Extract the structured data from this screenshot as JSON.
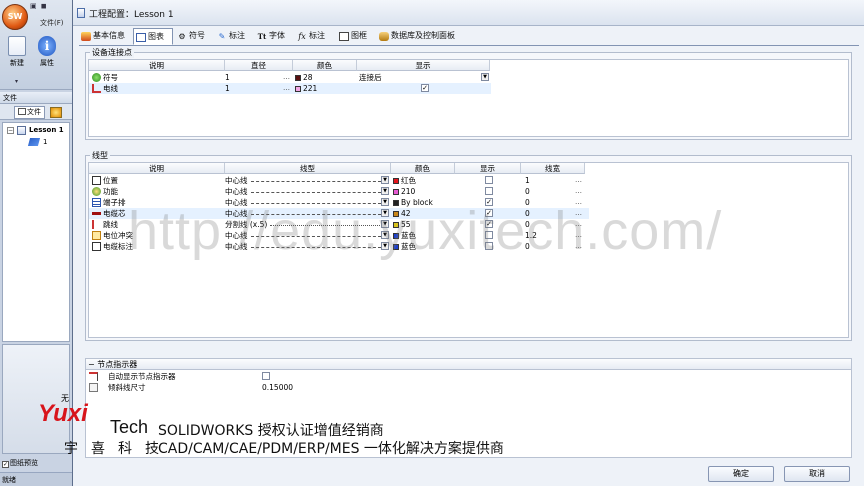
{
  "app": {
    "file_menu": "文件(F)",
    "ribbon": {
      "new_label": "新建",
      "properties_label": "属性"
    },
    "pane_header": "文件",
    "pane_tab_file": "文件",
    "tree": {
      "root": "Lesson 1",
      "child": "1"
    },
    "pane_bottom_text": "无",
    "preview_checkbox": "图纸预览",
    "status": "就绪"
  },
  "dialog": {
    "title": "工程配置：Lesson 1",
    "tabs": [
      {
        "label": "基本信息",
        "icon": "info-icon"
      },
      {
        "label": "图表",
        "icon": "chart-icon"
      },
      {
        "label": "符号",
        "icon": "symbol-icon"
      },
      {
        "label": "标注",
        "icon": "annotation-icon"
      },
      {
        "label": "字体",
        "icon": "font-icon"
      },
      {
        "label": "标注",
        "icon": "fx-icon"
      },
      {
        "label": "图框",
        "icon": "frame-icon"
      },
      {
        "label": "数据库及控制面板",
        "icon": "database-icon"
      }
    ],
    "tab_fx_glyph": "fx",
    "tab_font_glyph": "Tt",
    "connection_points": {
      "title": "设备连接点",
      "headers": [
        "说明",
        "直径",
        "颜色",
        "显示"
      ],
      "rows": [
        {
          "name": "符号",
          "diameter": "1",
          "color": "28",
          "color_hex": "#5a1010",
          "display": "连接后",
          "display_checked": false
        },
        {
          "name": "电线",
          "diameter": "1",
          "color": "221",
          "color_hex": "#f2a7e6",
          "display": "",
          "display_checked": true
        }
      ]
    },
    "line_types": {
      "title": "线型",
      "headers": [
        "说明",
        "线型",
        "颜色",
        "显示",
        "线宽"
      ],
      "rows": [
        {
          "name": "位置",
          "linetype": "中心线",
          "color": "红色",
          "color_hex": "#e3141b",
          "checked": false,
          "width": "1"
        },
        {
          "name": "功能",
          "linetype": "中心线",
          "color": "210",
          "color_hex": "#e65ad2",
          "checked": false,
          "width": "0"
        },
        {
          "name": "端子排",
          "linetype": "中心线",
          "color": "By block",
          "color_hex": "#222222",
          "checked": true,
          "width": "0"
        },
        {
          "name": "电缆芯",
          "linetype": "中心线",
          "color": "42",
          "color_hex": "#c8861a",
          "checked": true,
          "width": "0"
        },
        {
          "name": "跳线",
          "linetype": "分割线 (x.5)",
          "color": "55",
          "color_hex": "#d7c21c",
          "checked": true,
          "width": "0"
        },
        {
          "name": "电位冲突",
          "linetype": "中心线",
          "color": "蓝色",
          "color_hex": "#1a3fd0",
          "checked": false,
          "width": "1.2"
        },
        {
          "name": "电缆标注",
          "linetype": "中心线",
          "color": "蓝色",
          "color_hex": "#1a3fd0",
          "checked": false,
          "width": "0"
        }
      ]
    },
    "node_indicator": {
      "title": "节点指示器",
      "rows": [
        {
          "name": "自动显示节点指示器",
          "value": ""
        },
        {
          "name": "倾斜线尺寸",
          "value": "0.15000"
        }
      ]
    },
    "ok_label": "确定",
    "cancel_label": "取消"
  },
  "overlay": {
    "watermark": "http://edu.yuxitech.com/",
    "logo_text": "Yuxi",
    "logo_tech": "Tech",
    "line1": "SOLIDWORKS 授权认证增值经销商",
    "line2_name": "宇喜科技",
    "line2": "CAD/CAM/CAE/PDM/ERP/MES 一体化解决方案提供商"
  },
  "colors": {
    "accent": "#d8141b",
    "selection": "#e5f1ff"
  }
}
